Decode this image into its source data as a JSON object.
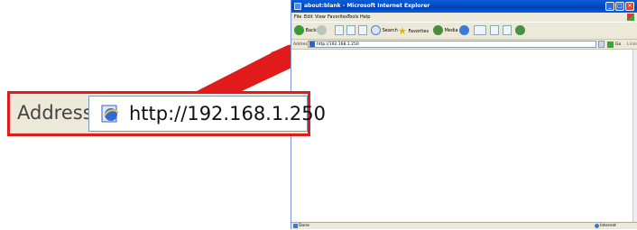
{
  "window": {
    "title": "about:blank - Microsoft Internet Explorer",
    "minimize": "_",
    "maximize": "□",
    "close": "✕"
  },
  "menu": [
    "File",
    "Edit",
    "View",
    "Favorites",
    "Tools",
    "Help"
  ],
  "toolbar": {
    "back_label": "Back",
    "search_label": "Search",
    "favorites_label": "Favorites",
    "media_label": "Media"
  },
  "address_bar": {
    "label": "Address",
    "url": "http://192.168.1.250",
    "go_label": "Go",
    "links_label": "Links"
  },
  "status_bar": {
    "left": "Done",
    "zone": "Internet"
  },
  "callout": {
    "label": "Address",
    "url": "http://192.168.1.250",
    "border_color": "#e11b1b",
    "arrow_color": "#e11b1b"
  }
}
